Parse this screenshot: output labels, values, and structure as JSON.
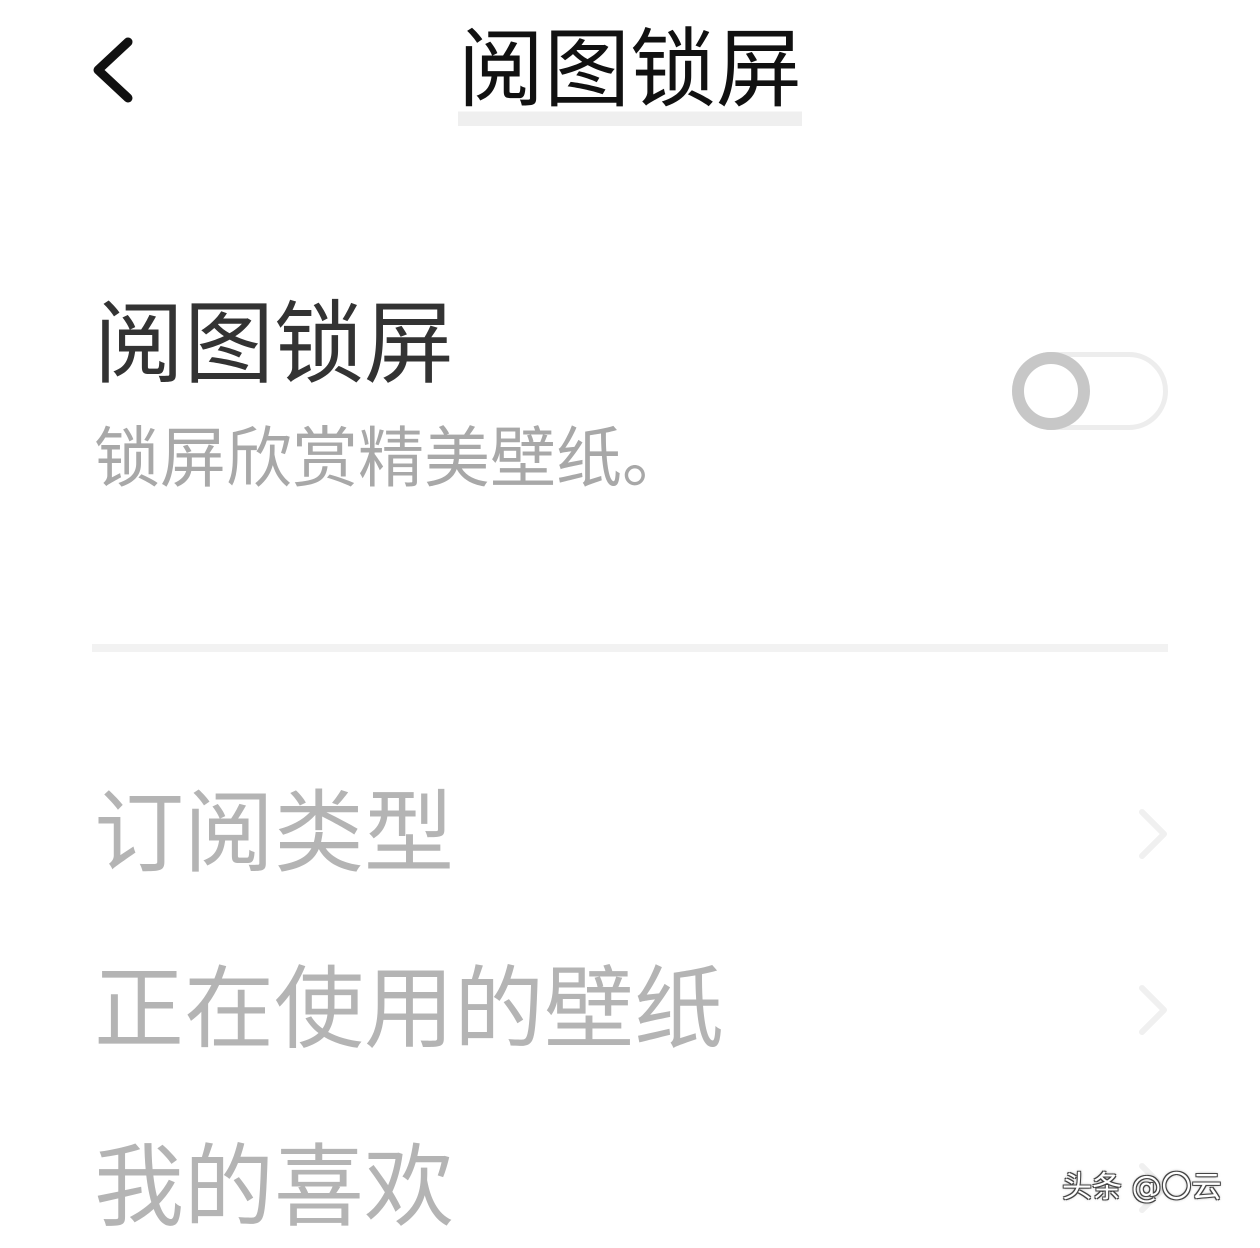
{
  "header": {
    "title": "阅图锁屏",
    "back_icon": "chevron-left-icon"
  },
  "setting": {
    "title": "阅图锁屏",
    "description": "锁屏欣赏精美壁纸。",
    "enabled": false
  },
  "menu": {
    "items": [
      {
        "label": "订阅类型",
        "icon": "chevron-right-icon"
      },
      {
        "label": "正在使用的壁纸",
        "icon": "chevron-right-icon"
      },
      {
        "label": "我的喜欢",
        "icon": "chevron-right-icon"
      }
    ]
  },
  "watermark": {
    "text": "头条 @〇云"
  },
  "colors": {
    "title_text": "#111111",
    "setting_title": "#333333",
    "secondary_text": "#a8a8a8",
    "disabled_text": "#b4b4b4",
    "toggle_off": "#c7c7c7",
    "divider": "#f2f2f2"
  }
}
